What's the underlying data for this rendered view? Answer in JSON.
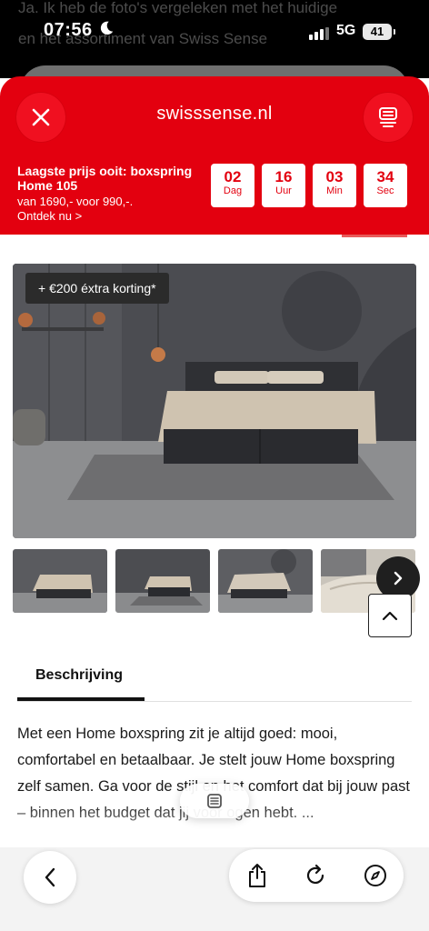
{
  "status_bar": {
    "time": "07:56",
    "network": "5G",
    "battery": "41",
    "background_text_line1": "Ja. Ik heb de foto's vergeleken met het huidige",
    "background_text_line2": "en het assortiment van Swiss Sense"
  },
  "header": {
    "site": "swisssense.nl",
    "close_icon": "close-icon",
    "menu_icon": "menu-icon",
    "accent_color": "#e3000f"
  },
  "promo": {
    "title": "Laagste prijs ooit: boxspring Home 105",
    "price": "van 1690,- voor 990,-.",
    "link": "Ontdek nu >"
  },
  "countdown": [
    {
      "value": "02",
      "unit": "Dag"
    },
    {
      "value": "16",
      "unit": "Uur"
    },
    {
      "value": "03",
      "unit": "Min"
    },
    {
      "value": "34",
      "unit": "Sec"
    }
  ],
  "product": {
    "badge": "+ €200 éxtra korting*"
  },
  "tabs": {
    "active": "Beschrijving"
  },
  "description": "Met een Home boxspring zit je altijd goed: mooi, comfortabel en betaalbaar. Je stelt jouw Home boxspring zelf samen. Ga voor de stijl en het comfort dat bij jouw past – binnen het budget dat jij voor ogen hebt. ...",
  "browser_bar": {
    "back_icon": "chevron-left-icon",
    "share_icon": "share-icon",
    "reload_icon": "reload-icon",
    "compass_icon": "compass-icon",
    "reader_icon": "reader-icon"
  }
}
